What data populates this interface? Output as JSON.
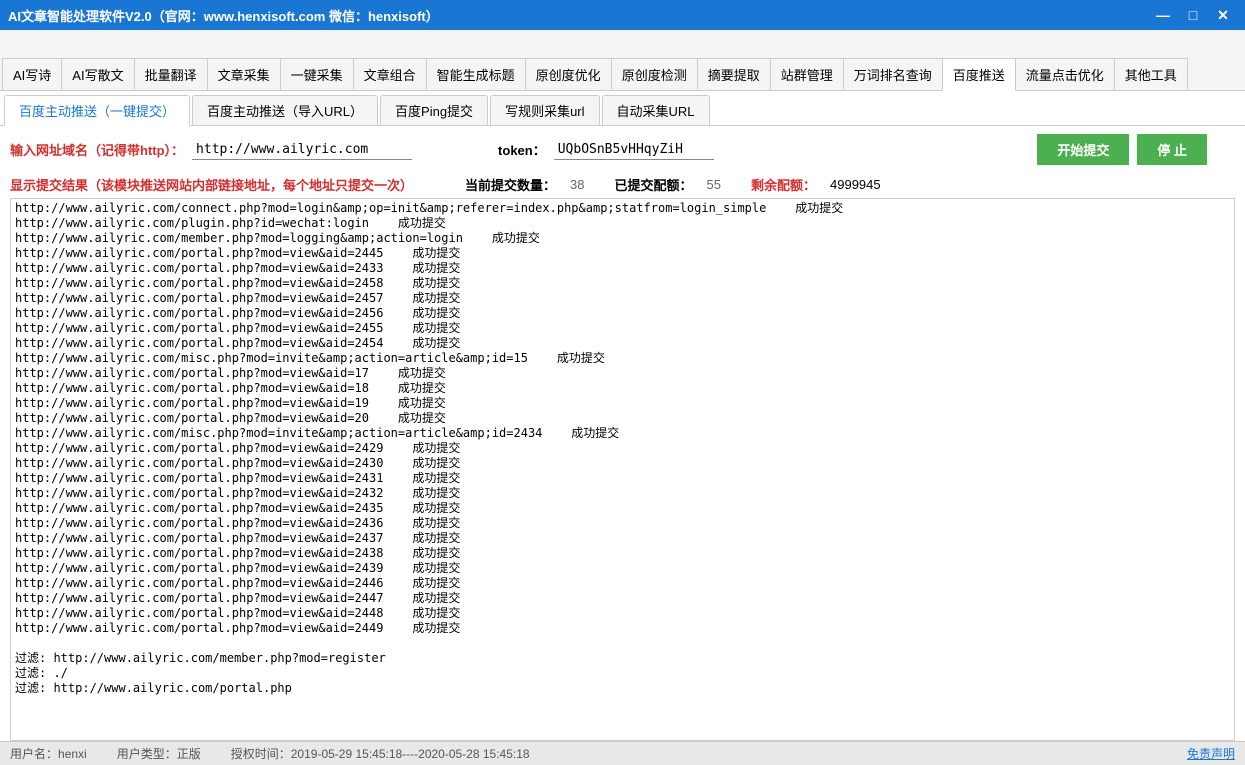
{
  "window": {
    "title": "AI文章智能处理软件V2.0（官网：www.henxisoft.com  微信：henxisoft）"
  },
  "main_tabs": [
    "AI写诗",
    "AI写散文",
    "批量翻译",
    "文章采集",
    "一键采集",
    "文章组合",
    "智能生成标题",
    "原创度优化",
    "原创度检测",
    "摘要提取",
    "站群管理",
    "万词排名查询",
    "百度推送",
    "流量点击优化",
    "其他工具"
  ],
  "main_tab_active_index": 12,
  "sub_tabs": [
    "百度主动推送（一键提交）",
    "百度主动推送（导入URL）",
    "百度Ping提交",
    "写规则采集url",
    "自动采集URL"
  ],
  "sub_tab_active_index": 0,
  "input": {
    "domain_label": "输入网址域名（记得带http）：",
    "domain_value": "http://www.ailyric.com",
    "token_label": "token：",
    "token_value": "UQbOSnB5vHHqyZiH",
    "start_btn": "开始提交",
    "stop_btn": "停  止"
  },
  "stats": {
    "result_label": "显示提交结果（该模块推送网站内部链接地址，每个地址只提交一次）",
    "current_label": "当前提交数量：",
    "current_value": "38",
    "submitted_label": "已提交配额：",
    "submitted_value": "55",
    "remain_label": "剩余配额：",
    "remain_value": "4999945"
  },
  "log_lines": [
    "http://www.ailyric.com/connect.php?mod=login&amp;op=init&amp;referer=index.php&amp;statfrom=login_simple    成功提交",
    "http://www.ailyric.com/plugin.php?id=wechat:login    成功提交",
    "http://www.ailyric.com/member.php?mod=logging&amp;action=login    成功提交",
    "http://www.ailyric.com/portal.php?mod=view&aid=2445    成功提交",
    "http://www.ailyric.com/portal.php?mod=view&aid=2433    成功提交",
    "http://www.ailyric.com/portal.php?mod=view&aid=2458    成功提交",
    "http://www.ailyric.com/portal.php?mod=view&aid=2457    成功提交",
    "http://www.ailyric.com/portal.php?mod=view&aid=2456    成功提交",
    "http://www.ailyric.com/portal.php?mod=view&aid=2455    成功提交",
    "http://www.ailyric.com/portal.php?mod=view&aid=2454    成功提交",
    "http://www.ailyric.com/misc.php?mod=invite&amp;action=article&amp;id=15    成功提交",
    "http://www.ailyric.com/portal.php?mod=view&aid=17    成功提交",
    "http://www.ailyric.com/portal.php?mod=view&aid=18    成功提交",
    "http://www.ailyric.com/portal.php?mod=view&aid=19    成功提交",
    "http://www.ailyric.com/portal.php?mod=view&aid=20    成功提交",
    "http://www.ailyric.com/misc.php?mod=invite&amp;action=article&amp;id=2434    成功提交",
    "http://www.ailyric.com/portal.php?mod=view&aid=2429    成功提交",
    "http://www.ailyric.com/portal.php?mod=view&aid=2430    成功提交",
    "http://www.ailyric.com/portal.php?mod=view&aid=2431    成功提交",
    "http://www.ailyric.com/portal.php?mod=view&aid=2432    成功提交",
    "http://www.ailyric.com/portal.php?mod=view&aid=2435    成功提交",
    "http://www.ailyric.com/portal.php?mod=view&aid=2436    成功提交",
    "http://www.ailyric.com/portal.php?mod=view&aid=2437    成功提交",
    "http://www.ailyric.com/portal.php?mod=view&aid=2438    成功提交",
    "http://www.ailyric.com/portal.php?mod=view&aid=2439    成功提交",
    "http://www.ailyric.com/portal.php?mod=view&aid=2446    成功提交",
    "http://www.ailyric.com/portal.php?mod=view&aid=2447    成功提交",
    "http://www.ailyric.com/portal.php?mod=view&aid=2448    成功提交",
    "http://www.ailyric.com/portal.php?mod=view&aid=2449    成功提交",
    "",
    "过滤: http://www.ailyric.com/member.php?mod=register",
    "过滤: ./",
    "过滤: http://www.ailyric.com/portal.php"
  ],
  "status": {
    "user_label": "用户名：",
    "user_value": "henxi",
    "type_label": "用户类型：",
    "type_value": "正版",
    "auth_label": "授权时间：",
    "auth_value": "2019-05-29 15:45:18----2020-05-28 15:45:18",
    "disclaimer": "免责声明"
  }
}
